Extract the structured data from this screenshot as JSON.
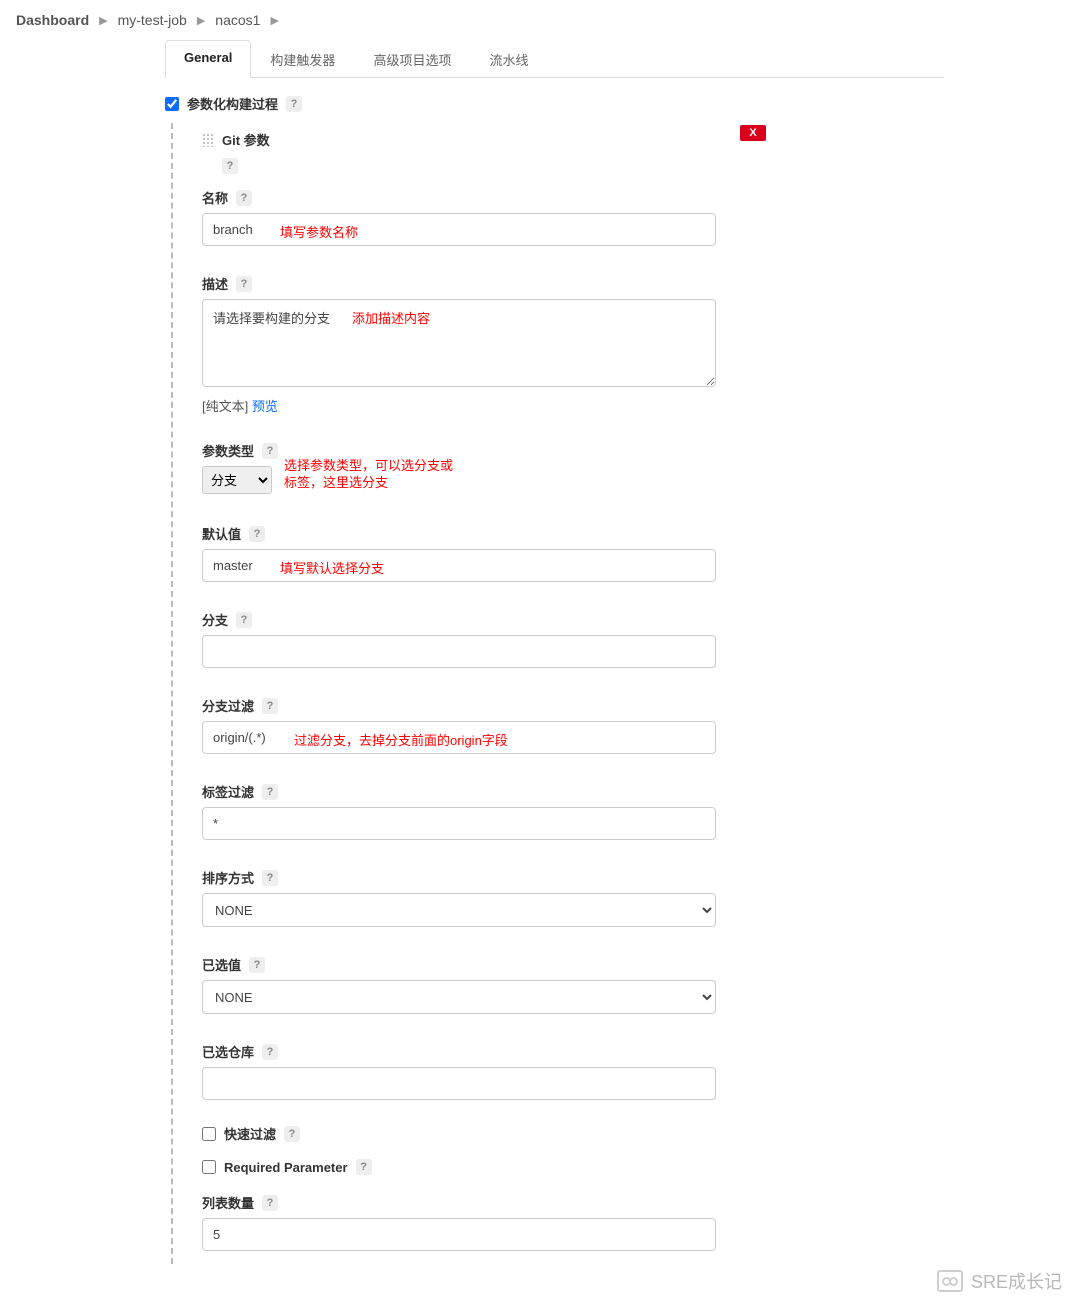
{
  "breadcrumb": {
    "items": [
      "Dashboard",
      "my-test-job",
      "nacos1"
    ]
  },
  "tabs": {
    "items": [
      "General",
      "构建触发器",
      "高级项目选项",
      "流水线"
    ],
    "active": 0
  },
  "paramCheck": {
    "label": "参数化构建过程",
    "checked": true
  },
  "git": {
    "title": "Git 参数",
    "deleteLabel": "X"
  },
  "fields": {
    "name": {
      "label": "名称",
      "value": "branch",
      "anno": "填写参数名称"
    },
    "desc": {
      "label": "描述",
      "value": "请选择要构建的分支",
      "anno": "添加描述内容"
    },
    "descHint": {
      "plain": "[纯文本] ",
      "link": "预览"
    },
    "paramType": {
      "label": "参数类型",
      "value": "分支",
      "anno": "选择参数类型，可以选分支或标签，这里选分支"
    },
    "default": {
      "label": "默认值",
      "value": "master",
      "anno": "填写默认选择分支"
    },
    "branch": {
      "label": "分支",
      "value": ""
    },
    "branchFilter": {
      "label": "分支过滤",
      "value": "origin/(.*)",
      "anno": "过滤分支，去掉分支前面的origin字段"
    },
    "tagFilter": {
      "label": "标签过滤",
      "value": "*"
    },
    "sort": {
      "label": "排序方式",
      "value": "NONE"
    },
    "selected": {
      "label": "已选值",
      "value": "NONE"
    },
    "repo": {
      "label": "已选仓库",
      "value": ""
    },
    "quickFilter": {
      "label": "快速过滤",
      "checked": false
    },
    "required": {
      "label": "Required Parameter",
      "checked": false
    },
    "listCount": {
      "label": "列表数量",
      "value": "5"
    }
  },
  "watermark": "SRE成长记"
}
